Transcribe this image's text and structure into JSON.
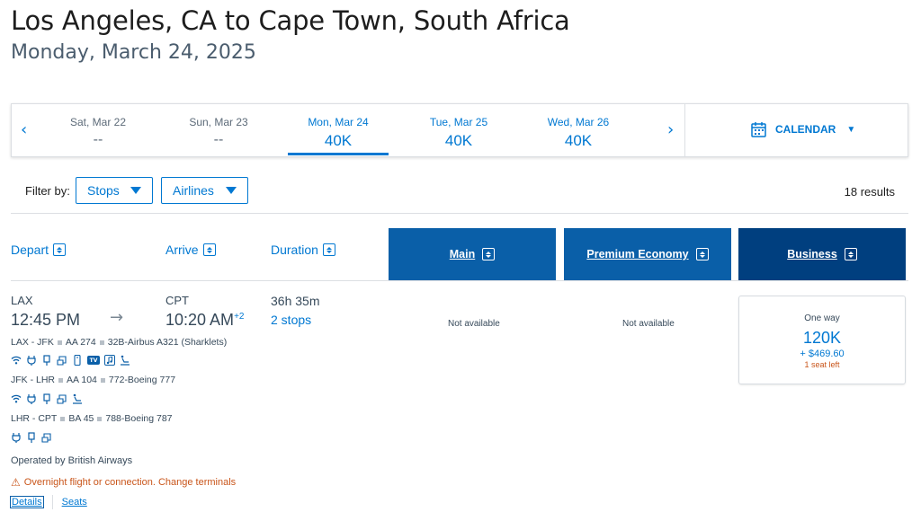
{
  "header": {
    "title": "Los Angeles, CA to Cape Town, South Africa",
    "date": "Monday, March 24, 2025"
  },
  "date_carousel": {
    "prev_icon": "chevron-left",
    "next_icon": "chevron-right",
    "days": [
      {
        "label": "Sat, Mar 22",
        "price": "--"
      },
      {
        "label": "Sun, Mar 23",
        "price": "--"
      },
      {
        "label": "Mon, Mar 24",
        "price": "40K"
      },
      {
        "label": "Tue, Mar 25",
        "price": "40K"
      },
      {
        "label": "Wed, Mar 26",
        "price": "40K"
      }
    ],
    "calendar_label": "CALENDAR"
  },
  "filters": {
    "label": "Filter by:",
    "stops": "Stops",
    "airlines": "Airlines",
    "results": "18 results"
  },
  "columns": {
    "depart": "Depart",
    "arrive": "Arrive",
    "duration": "Duration",
    "main": "Main",
    "premium": "Premium Economy",
    "business": "Business"
  },
  "flight": {
    "origin": "LAX",
    "destination": "CPT",
    "depart_time": "12:45 PM",
    "arrive_time": "10:20 AM",
    "day_offset": "+2",
    "duration": "36h 35m",
    "stops": "2 stops",
    "segments": [
      {
        "route": "LAX - JFK",
        "flight": "AA 274",
        "aircraft": "32B-Airbus A321 (Sharklets)"
      },
      {
        "route": "JFK - LHR",
        "flight": "AA 104",
        "aircraft": "772-Boeing 777"
      },
      {
        "route": "LHR - CPT",
        "flight": "BA 45",
        "aircraft": "788-Boeing 787"
      }
    ],
    "amenities_tv_label": "TV",
    "operated_by": "Operated by British Airways",
    "warning": "Overnight flight or connection. Change terminals",
    "details_link": "Details",
    "seats_link": "Seats",
    "main_price": "Not available",
    "premium_price": "Not available",
    "business": {
      "trip_type": "One way",
      "miles": "120K",
      "taxes": "+ $469.60",
      "seats_left": "1 seat left"
    }
  }
}
